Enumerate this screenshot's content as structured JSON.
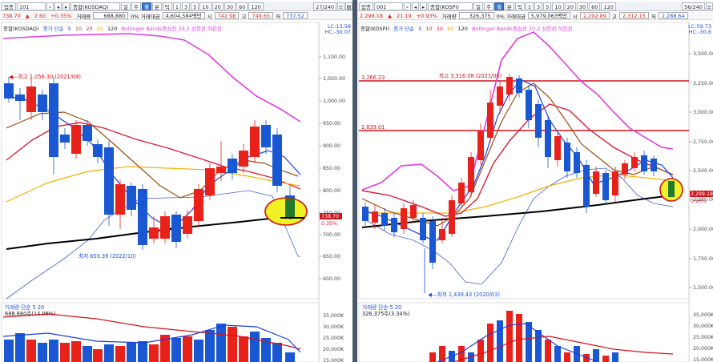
{
  "left": {
    "toolbar": {
      "industry": "업종",
      "code": "101",
      "name": "종합(KOSDAQ)",
      "periods": [
        "일",
        "주",
        "월",
        "분",
        "틱"
      ],
      "minutes": [
        "1",
        "3",
        "5",
        "10",
        "20",
        "30",
        "60",
        "120"
      ],
      "count": "27/240"
    },
    "quote": {
      "price": "738.70",
      "change": "2.60",
      "change_pct": "+0.35%",
      "volume_label": "거래량",
      "volume": "688,880",
      "amount_label": "0% 거래대금",
      "amount": "4,604,584백만",
      "open_label": "시",
      "open": "742.98",
      "high_label": "고",
      "high": "749.65",
      "low_label": "저",
      "low": "737.52"
    },
    "legend": {
      "index": "종합(KOSDAQ)",
      "ma_label": "종가 단순",
      "ma": [
        "5",
        "10",
        "20",
        "60",
        "120"
      ],
      "bb": "Bollinger Bands중심선 20,2 상한선  하한선"
    },
    "lc": [
      "LC:13.58",
      "HC:-30.07"
    ],
    "annotations": {
      "high": "최고 1,056.30 (2021/09)",
      "low": "최저 650.39 (2022/10)"
    },
    "price_tag": {
      "price": "738.70",
      "pct": "0.35%"
    },
    "volume": {
      "title": "거래량 단순 5 20",
      "value": "688,880주(14.06%)",
      "axis": [
        "35,000K",
        "30,000K",
        "25,000K",
        "20,000K",
        "15,000K"
      ]
    },
    "axis": [
      "1,100.00",
      "1,050.00",
      "1,000.00",
      "950.00",
      "900.00",
      "850.00",
      "800.00",
      "750.00",
      "700.00",
      "650.00",
      "600.00"
    ],
    "colors": {
      "up": "#e8221b",
      "down": "#1a57d3",
      "ma5": "#1c3ee0",
      "ma10": "#9b4d18",
      "ma20": "#dc1c3a",
      "ma60": "#f0b300",
      "ma120": "#000000",
      "bb": "#e23be0",
      "bblow": "#4a5ed8"
    }
  },
  "right": {
    "toolbar": {
      "industry": "업종",
      "code": "001",
      "name": "종합(KOSPI)",
      "periods": [
        "일",
        "주",
        "월",
        "분",
        "틱"
      ],
      "minutes": [
        "1",
        "3",
        "5",
        "10",
        "20",
        "30",
        "60",
        "120"
      ],
      "count": "56/240"
    },
    "quote": {
      "price": "2,299.18",
      "change": "21.19",
      "change_pct": "+0.93%",
      "volume_label": "거래량",
      "volume": "326,375",
      "amount_label": "0% 거래대금",
      "amount": "5,979,063백만",
      "open_label": "시",
      "open": "2,292.89",
      "high_label": "고",
      "high": "2,312.15",
      "low_label": "저",
      "low": "2,288.64"
    },
    "legend": {
      "index": "종합(KOSPI)",
      "ma_label": "종가 단순",
      "ma": [
        "5",
        "10",
        "20",
        "60",
        "120"
      ],
      "bb": "Bollinger Bands중심선 20,2 상한선  하한선"
    },
    "lc": [
      "LC:59.73",
      "HC:-30.6"
    ],
    "annotations": {
      "high": "최고 3,316.08 (2021/06)",
      "low": "최저 1,439.43 (2020/03)",
      "line1": "3,266.23",
      "line2": "2,839.01"
    },
    "price_tag": {
      "price": "2,299.18",
      "pct": "0.93%"
    },
    "volume": {
      "title": "거래량 단순 5 20",
      "value": "326,375주(3.34%)",
      "axis": [
        "35,000K",
        "30,000K",
        "25,000K",
        "20,000K",
        "15,000K"
      ]
    },
    "axis": [
      "3,500.00",
      "3,250.00",
      "3,000.00",
      "2,750.00",
      "2,500.00",
      "2,250.00",
      "2,000.00",
      "1,750.00",
      "1,500.00"
    ]
  }
}
